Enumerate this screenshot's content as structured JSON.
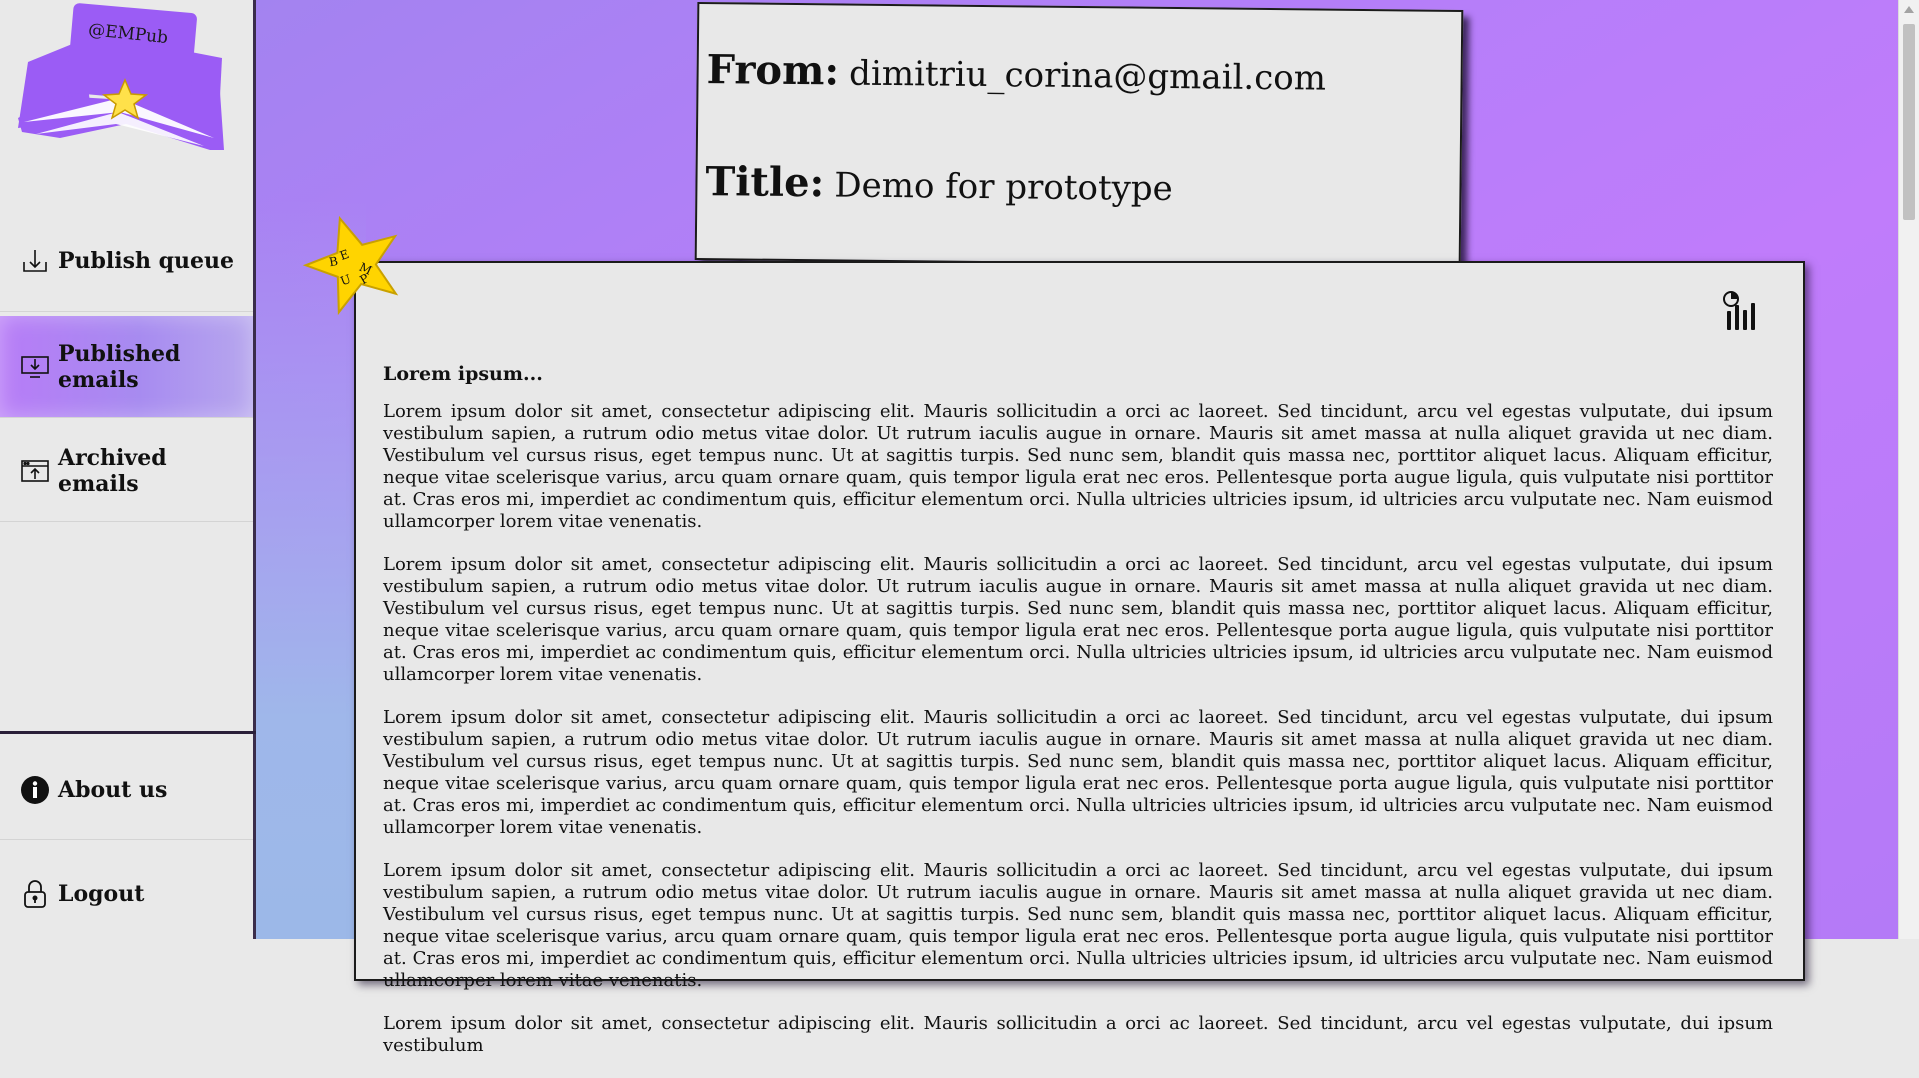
{
  "brand": {
    "logo_text": "@EMPub",
    "star_letters": [
      "E",
      "M",
      "P",
      "U",
      "B"
    ]
  },
  "sidebar": {
    "items": [
      {
        "label": "Publish queue",
        "icon": "inbox-download-icon"
      },
      {
        "label": "Published emails",
        "icon": "monitor-download-icon",
        "active": true
      },
      {
        "label": "Archived emails",
        "icon": "archive-upload-icon"
      }
    ],
    "bottom_items": [
      {
        "label": "About us",
        "icon": "info-icon"
      },
      {
        "label": "Logout",
        "icon": "lock-icon"
      }
    ]
  },
  "email": {
    "from_label": "From:",
    "from_value": "dimitriu_corina@gmail.com",
    "title_label": "Title:",
    "title_value": "Demo for prototype",
    "heading": "Lorem ipsum...",
    "paragraphs": [
      "Lorem ipsum dolor sit amet, consectetur adipiscing elit. Mauris sollicitudin a orci ac laoreet. Sed tincidunt, arcu vel egestas vulputate, dui ipsum vestibulum sapien, a rutrum odio metus vitae dolor. Ut rutrum iaculis augue in ornare. Mauris sit amet massa at nulla aliquet gravida ut nec diam. Vestibulum vel cursus risus, eget tempus nunc. Ut at sagittis turpis. Sed nunc sem, blandit quis massa nec, porttitor aliquet lacus. Aliquam efficitur, neque vitae scelerisque varius, arcu quam ornare quam, quis tempor ligula erat nec eros. Pellentesque porta augue ligula, quis vulputate nisi porttitor at. Cras eros mi, imperdiet ac condimentum quis, efficitur elementum orci. Nulla ultricies ultricies ipsum, id ultricies arcu vulputate nec. Nam euismod ullamcorper lorem vitae venenatis.",
      "Lorem ipsum dolor sit amet, consectetur adipiscing elit. Mauris sollicitudin a orci ac laoreet. Sed tincidunt, arcu vel egestas vulputate, dui ipsum vestibulum sapien, a rutrum odio metus vitae dolor. Ut rutrum iaculis augue in ornare. Mauris sit amet massa at nulla aliquet gravida ut nec diam. Vestibulum vel cursus risus, eget tempus nunc. Ut at sagittis turpis. Sed nunc sem, blandit quis massa nec, porttitor aliquet lacus. Aliquam efficitur, neque vitae scelerisque varius, arcu quam ornare quam, quis tempor ligula erat nec eros. Pellentesque porta augue ligula, quis vulputate nisi porttitor at. Cras eros mi, imperdiet ac condimentum quis, efficitur elementum orci. Nulla ultricies ultricies ipsum, id ultricies arcu vulputate nec. Nam euismod ullamcorper lorem vitae venenatis.",
      "Lorem ipsum dolor sit amet, consectetur adipiscing elit. Mauris sollicitudin a orci ac laoreet. Sed tincidunt, arcu vel egestas vulputate, dui ipsum vestibulum sapien, a rutrum odio metus vitae dolor. Ut rutrum iaculis augue in ornare. Mauris sit amet massa at nulla aliquet gravida ut nec diam. Vestibulum vel cursus risus, eget tempus nunc. Ut at sagittis turpis. Sed nunc sem, blandit quis massa nec, porttitor aliquet lacus. Aliquam efficitur, neque vitae scelerisque varius, arcu quam ornare quam, quis tempor ligula erat nec eros. Pellentesque porta augue ligula, quis vulputate nisi porttitor at. Cras eros mi, imperdiet ac condimentum quis, efficitur elementum orci. Nulla ultricies ultricies ipsum, id ultricies arcu vulputate nec. Nam euismod ullamcorper lorem vitae venenatis.",
      "Lorem ipsum dolor sit amet, consectetur adipiscing elit. Mauris sollicitudin a orci ac laoreet. Sed tincidunt, arcu vel egestas vulputate, dui ipsum vestibulum sapien, a rutrum odio metus vitae dolor. Ut rutrum iaculis augue in ornare. Mauris sit amet massa at nulla aliquet gravida ut nec diam. Vestibulum vel cursus risus, eget tempus nunc. Ut at sagittis turpis. Sed nunc sem, blandit quis massa nec, porttitor aliquet lacus. Aliquam efficitur, neque vitae scelerisque varius, arcu quam ornare quam, quis tempor ligula erat nec eros. Pellentesque porta augue ligula, quis vulputate nisi porttitor at. Cras eros mi, imperdiet ac condimentum quis, efficitur elementum orci. Nulla ultricies ultricies ipsum, id ultricies arcu vulputate nec. Nam euismod ullamcorper lorem vitae venenatis.",
      "Lorem ipsum dolor sit amet, consectetur adipiscing elit. Mauris sollicitudin a orci ac laoreet. Sed tincidunt, arcu vel egestas vulputate, dui ipsum vestibulum"
    ]
  },
  "colors": {
    "brand_purple": "#9b5cf5",
    "star_yellow": "#ffd400",
    "bg_gradient_start": "#a383f0",
    "bg_gradient_end": "#c07cfb",
    "card_bg": "#e8e8e8"
  }
}
